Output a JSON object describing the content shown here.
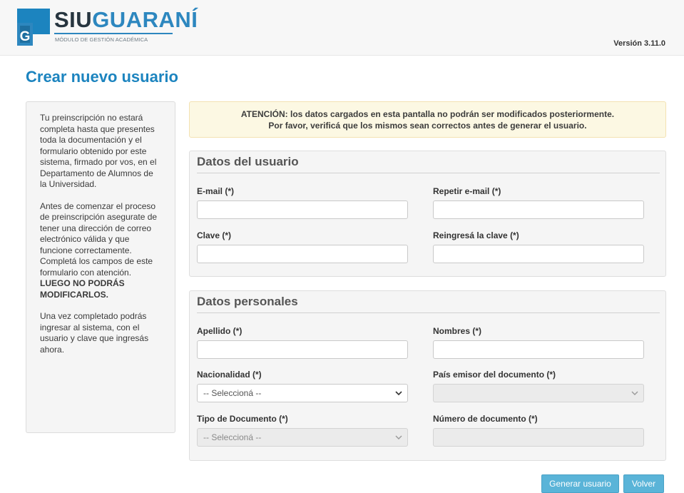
{
  "header": {
    "brand_siu": "SIU",
    "brand_guarani": "GUARANÍ",
    "brand_subtitle": "MÓDULO DE GESTIÓN ACADÉMICA",
    "version": "Versión 3.11.0",
    "logo_letter": "G"
  },
  "page": {
    "title": "Crear nuevo usuario"
  },
  "sidebar": {
    "paragraph1": "Tu preinscripción no estará completa hasta que presentes toda la documentación y el formulario obtenido por este sistema, firmado por vos, en el Departamento de Alumnos de la Universidad.",
    "paragraph2": "Antes de comenzar el proceso de preinscripción asegurate de tener una dirección de correo electrónico válida y que funcione correctamente. Completá los campos de este formulario con atención.",
    "paragraph2_bold": "LUEGO NO PODRÁS MODIFICARLOS.",
    "paragraph3": "Una vez completado podrás ingresar al sistema, con el usuario y clave que ingresás ahora."
  },
  "alert": {
    "line1_strong": "ATENCIÓN:",
    "line1_rest": " los datos cargados en esta pantalla no podrán ser modificados posteriormente.",
    "line2": "Por favor, verificá que los mismos sean correctos antes de generar el usuario."
  },
  "user_section": {
    "title": "Datos del usuario",
    "email_label": "E-mail (*)",
    "email_value": "",
    "repeat_email_label": "Repetir e-mail (*)",
    "repeat_email_value": "",
    "password_label": "Clave (*)",
    "password_value": "",
    "repeat_password_label": "Reingresá la clave (*)",
    "repeat_password_value": ""
  },
  "personal_section": {
    "title": "Datos personales",
    "lastname_label": "Apellido (*)",
    "lastname_value": "",
    "firstname_label": "Nombres (*)",
    "firstname_value": "",
    "nationality_label": "Nacionalidad (*)",
    "nationality_selected": "-- Seleccioná --",
    "issuer_country_label": "País emisor del documento (*)",
    "issuer_country_selected": "",
    "doc_type_label": "Tipo de Documento (*)",
    "doc_type_selected": "-- Seleccioná --",
    "doc_number_label": "Número de documento (*)",
    "doc_number_value": ""
  },
  "actions": {
    "generate_label": "Generar usuario",
    "back_label": "Volver"
  },
  "colors": {
    "accent": "#1c84bf",
    "button": "#5ab4d8",
    "alert_bg": "#fcf8e3",
    "panel_bg": "#f5f5f5"
  }
}
